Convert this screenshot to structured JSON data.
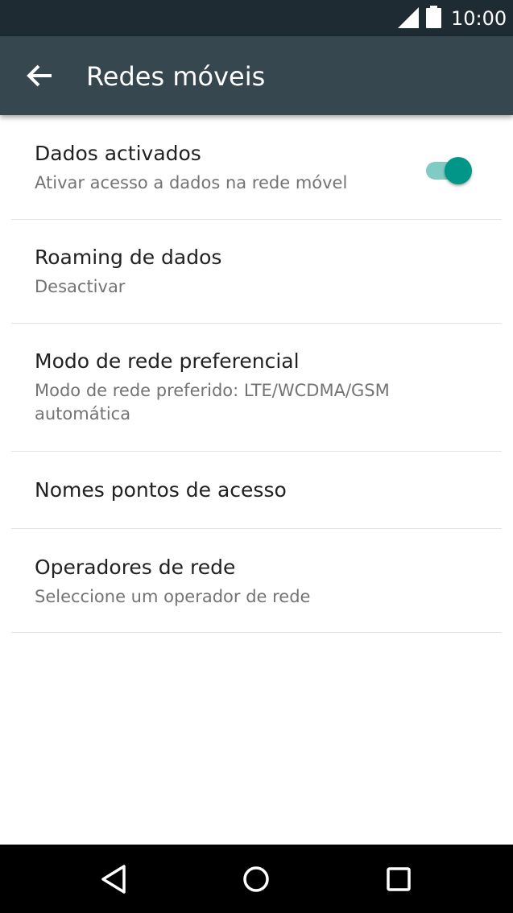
{
  "status_bar": {
    "time": "10:00",
    "icons": [
      "signal-icon",
      "battery-icon"
    ]
  },
  "app_bar": {
    "back_icon": "arrow-back-icon",
    "title": "Redes móveis"
  },
  "settings": [
    {
      "label": "Dados activados",
      "summary": "Ativar acesso a dados na rede móvel",
      "toggle": true
    },
    {
      "label": "Roaming de dados",
      "summary": "Desactivar"
    },
    {
      "label": "Modo de rede preferencial",
      "summary": "Modo de rede preferido: LTE/WCDMA/GSM automática"
    },
    {
      "label": "Nomes pontos de acesso"
    },
    {
      "label": "Operadores de rede",
      "summary": "Seleccione um operador de rede"
    }
  ],
  "colors": {
    "status_bar": "#1f2b32",
    "app_bar": "#37474f",
    "accent": "#009688",
    "accent_track": "#80cbc4",
    "primary_text": "#212121",
    "secondary_text": "#737373",
    "divider": "#e3e3e3"
  },
  "nav_bar": {
    "icons": [
      "back-triangle-icon",
      "home-circle-icon",
      "recents-square-icon"
    ]
  }
}
